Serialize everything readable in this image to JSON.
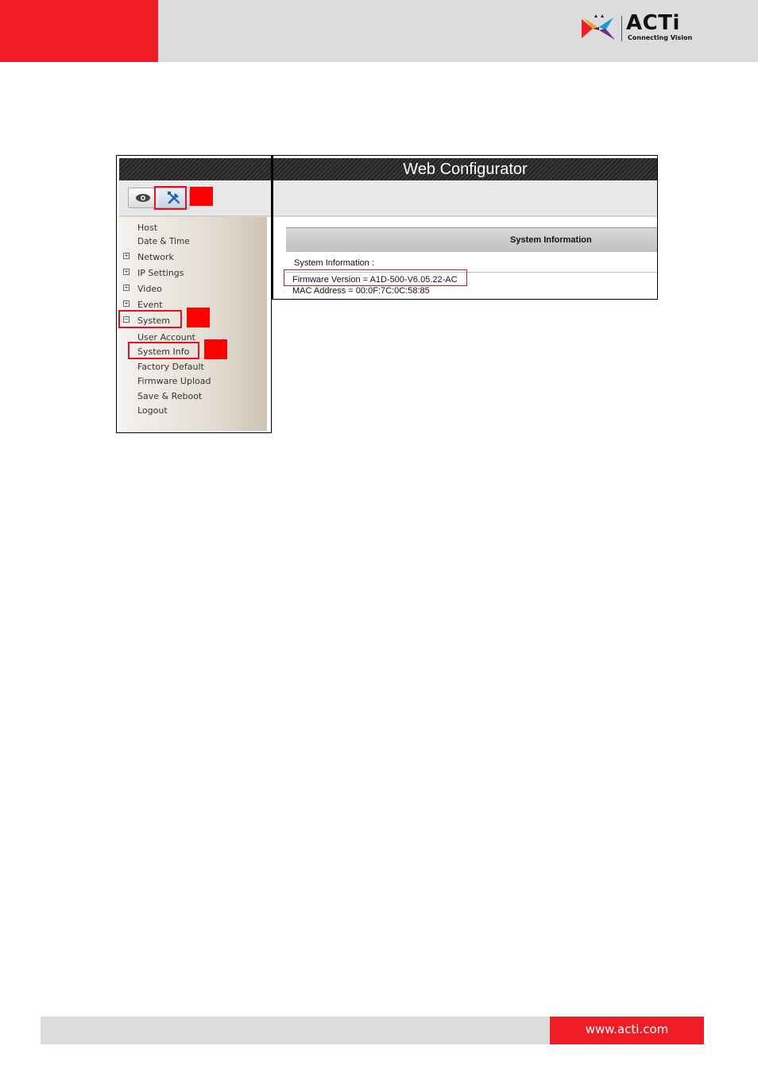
{
  "brand": {
    "name": "ACTi",
    "tagline": "Connecting Vision",
    "url": "www.acti.com",
    "colors": {
      "red": "#ee1c25",
      "gray": "#dcdcdc"
    }
  },
  "web_configurator": {
    "title": "Web Configurator",
    "toolbar": {
      "view_icon": "eye-icon",
      "setup_icon": "tools-icon"
    },
    "menu": {
      "items": [
        {
          "label": "Host"
        },
        {
          "label": "Date & Time"
        },
        {
          "label": "Network",
          "expander": "+"
        },
        {
          "label": "IP Settings",
          "expander": "+"
        },
        {
          "label": "Video",
          "expander": "+"
        },
        {
          "label": "Event",
          "expander": "+"
        },
        {
          "label": "System",
          "expander": "−"
        },
        {
          "label": "User Account"
        },
        {
          "label": "System Info"
        },
        {
          "label": "Factory Default"
        },
        {
          "label": "Firmware Upload"
        },
        {
          "label": "Save & Reboot"
        },
        {
          "label": "Logout"
        }
      ]
    },
    "system_information": {
      "header": "System Information",
      "label": "System Information :",
      "firmware": "Firmware Version = A1D-500-V6.05.22-AC",
      "mac": "MAC Address = 00:0F:7C:0C:58:85"
    }
  }
}
